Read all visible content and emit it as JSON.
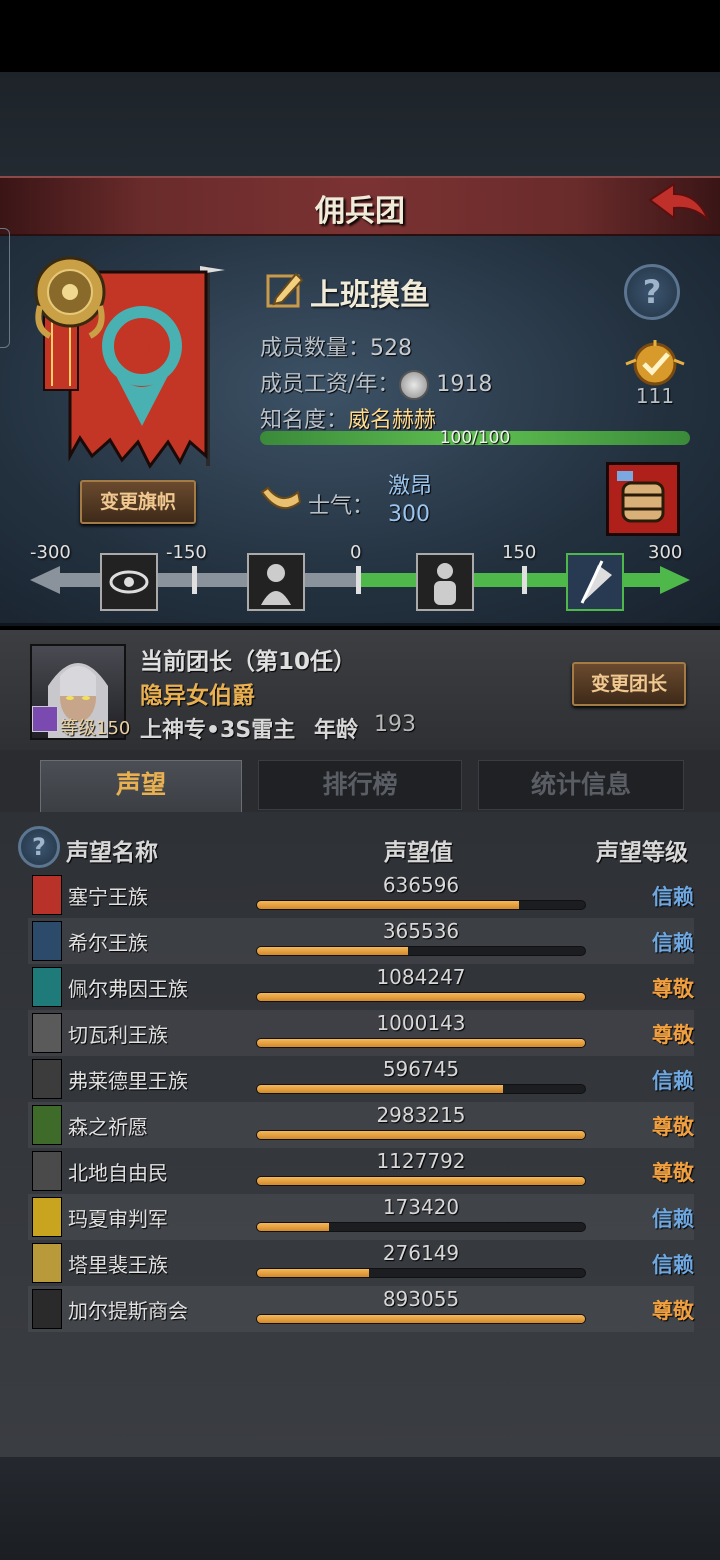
{
  "header": {
    "title": "佣兵团"
  },
  "guild": {
    "name": "上班摸鱼",
    "members_label": "成员数量：",
    "members_value": "528",
    "salary_label": "成员工资/年：",
    "salary_value": "1918",
    "fame_label": "知名度：",
    "fame_value": "威名赫赫",
    "fame_progress_text": "100/100",
    "fame_progress": 1.0,
    "achievement_value": "111",
    "change_banner_label": "变更旗帜"
  },
  "morale": {
    "label": "士气：",
    "status": "激昂",
    "value": "300",
    "scale_ticks": [
      "-300",
      "-150",
      "0",
      "150",
      "300"
    ],
    "current": 300,
    "min": -300,
    "max": 300
  },
  "leader": {
    "heading": "当前团长（第10任）",
    "title": "隐异女伯爵",
    "level_label": "等级150",
    "specialty": "上神专•3S雷主",
    "age_label": "年龄",
    "age_value": "193",
    "change_label": "变更团长"
  },
  "tabs": [
    {
      "label": "声望",
      "active": true
    },
    {
      "label": "排行榜",
      "active": false
    },
    {
      "label": "统计信息",
      "active": false
    }
  ],
  "reputation": {
    "col_name": "声望名称",
    "col_value": "声望值",
    "col_level": "声望等级",
    "rows": [
      {
        "name": "塞宁王族",
        "value": "636596",
        "progress": 0.8,
        "level": "信赖",
        "color": "#b8322a"
      },
      {
        "name": "希尔王族",
        "value": "365536",
        "progress": 0.46,
        "level": "信赖",
        "color": "#2c4a6a"
      },
      {
        "name": "佩尔弗因王族",
        "value": "1084247",
        "progress": 1.0,
        "level": "尊敬",
        "color": "#1f7a7a"
      },
      {
        "name": "切瓦利王族",
        "value": "1000143",
        "progress": 1.0,
        "level": "尊敬",
        "color": "#5a5a5a"
      },
      {
        "name": "弗莱德里王族",
        "value": "596745",
        "progress": 0.75,
        "level": "信赖",
        "color": "#3c3c3c"
      },
      {
        "name": "森之祈愿",
        "value": "2983215",
        "progress": 1.0,
        "level": "尊敬",
        "color": "#3e6a2a"
      },
      {
        "name": "北地自由民",
        "value": "1127792",
        "progress": 1.0,
        "level": "尊敬",
        "color": "#4a4a4a"
      },
      {
        "name": "玛夏审判军",
        "value": "173420",
        "progress": 0.22,
        "level": "信赖",
        "color": "#c9a41f"
      },
      {
        "name": "塔里裴王族",
        "value": "276149",
        "progress": 0.34,
        "level": "信赖",
        "color": "#b89a3a"
      },
      {
        "name": "加尔提斯商会",
        "value": "893055",
        "progress": 1.0,
        "level": "尊敬",
        "color": "#2a2a2a"
      }
    ]
  },
  "colors": {
    "trust": "#6fa8e0",
    "respect": "#f0a040"
  }
}
